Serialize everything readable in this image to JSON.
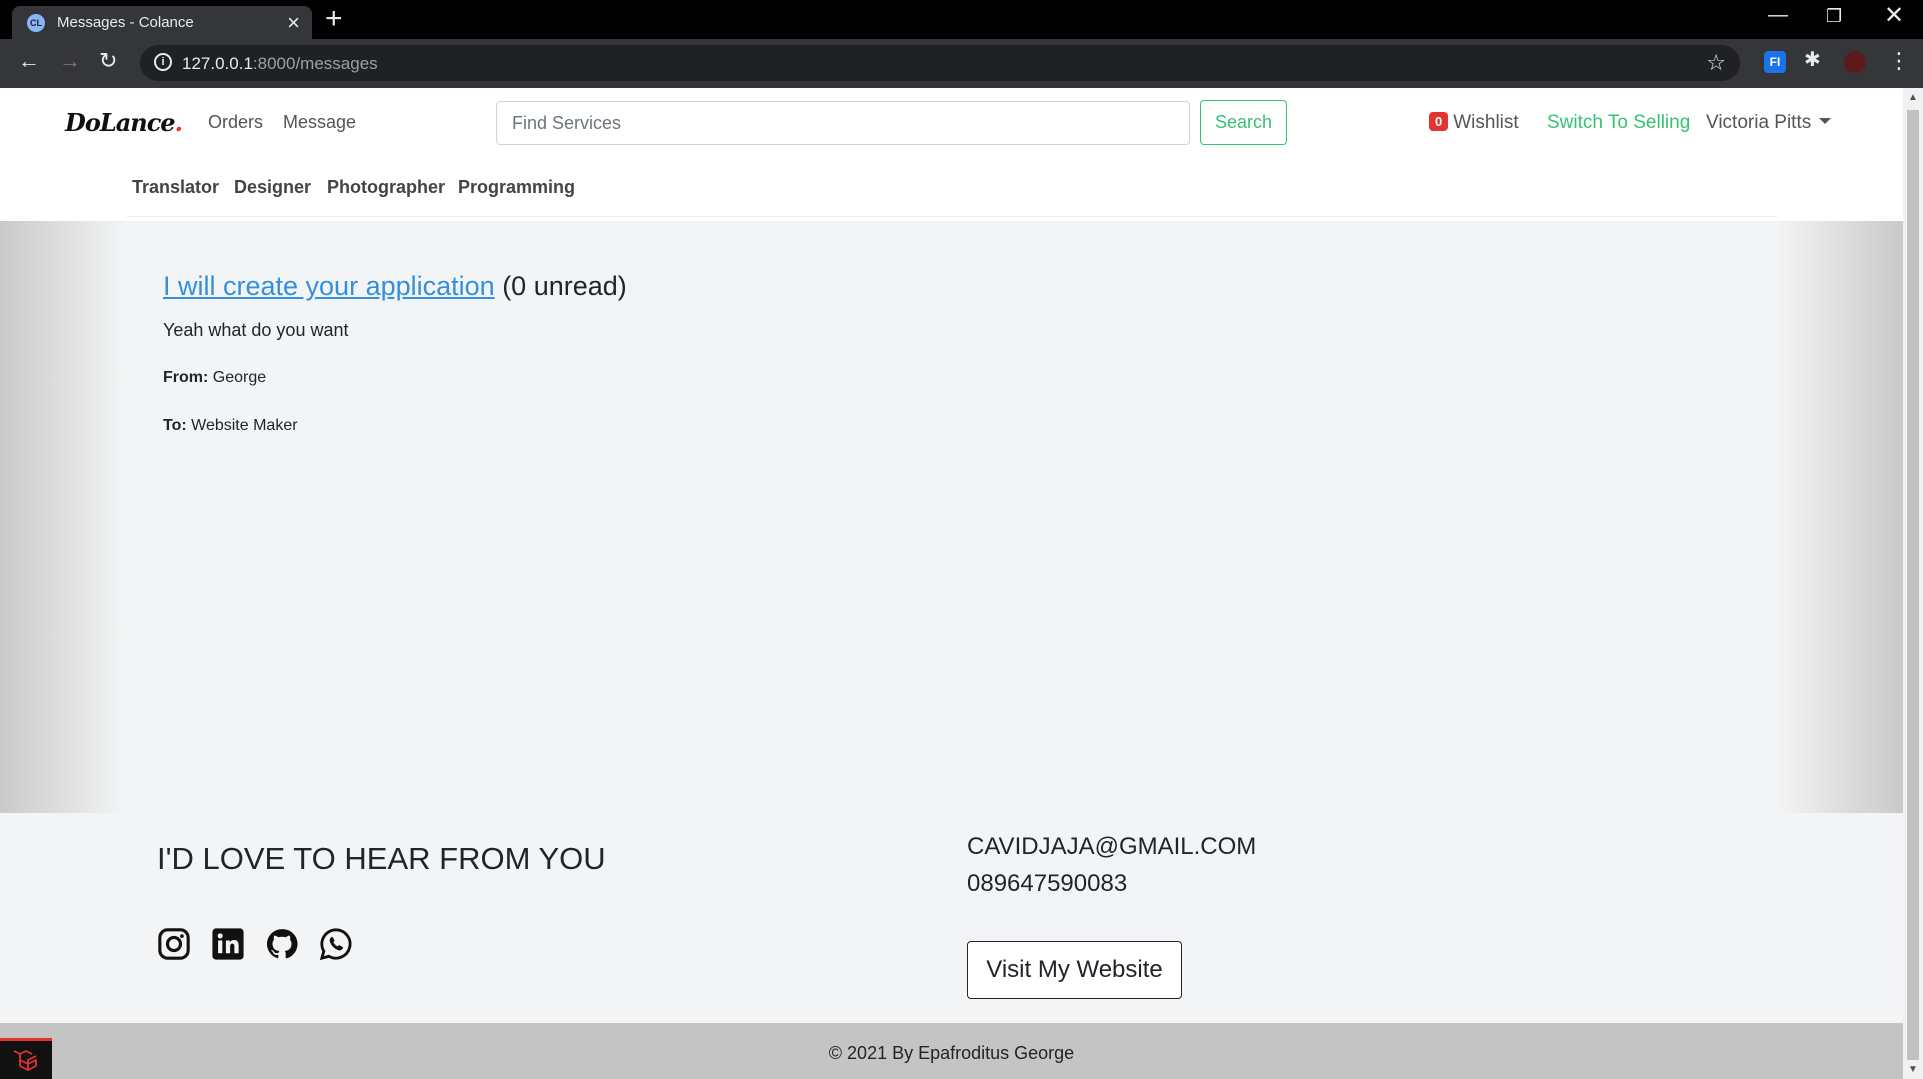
{
  "browser": {
    "tab_title": "Messages - Colance",
    "favicon_text": "CL",
    "url_host": "127.0.0.1",
    "url_rest": ":8000/messages",
    "extension_label": "FI"
  },
  "header": {
    "logo_text": "DoLance",
    "logo_dot": ".",
    "nav": [
      "Orders",
      "Message"
    ],
    "search_placeholder": "Find Services",
    "search_button": "Search",
    "wishlist_count": "0",
    "wishlist_label": "Wishlist",
    "switch_label": "Switch To Selling",
    "user_name": "Victoria Pitts"
  },
  "categories": [
    "Translator",
    "Designer",
    "Photographer",
    "Programming"
  ],
  "message": {
    "title_link": "I will create your application",
    "unread": "(0 unread)",
    "body": "Yeah what do you want",
    "from_label": "From:",
    "from_value": "George",
    "to_label": "To:",
    "to_value": "Website Maker"
  },
  "footer": {
    "heading": "I'D LOVE TO HEAR FROM YOU",
    "email": "CAVIDJAJA@GMAIL.COM",
    "phone": "089647590083",
    "visit_button": "Visit My Website",
    "social_icons": [
      "instagram-icon",
      "linkedin-icon",
      "github-icon",
      "whatsapp-icon"
    ],
    "copyright": "© 2021 By Epafroditus George"
  },
  "colors": {
    "accent_green": "#38c172",
    "link_blue": "#3490dc",
    "badge_red": "#e3342f"
  }
}
